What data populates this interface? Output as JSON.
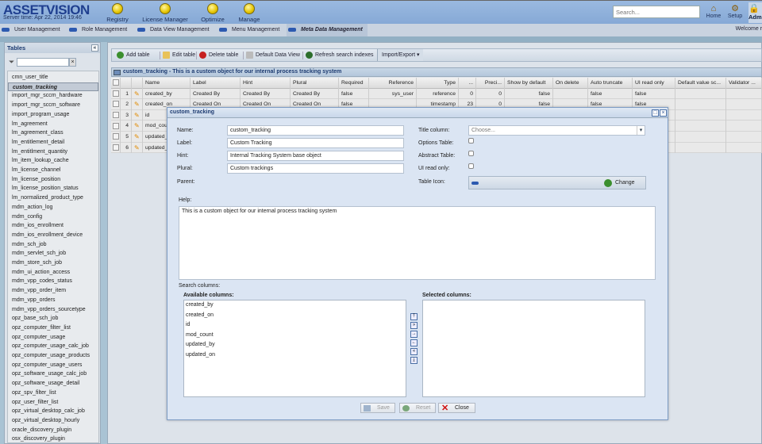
{
  "app": {
    "logo": "AssetVision",
    "server_time": "Server time: Apr 22, 2014 19:46"
  },
  "header": {
    "nav": [
      {
        "label": "Registry",
        "icon": "registry-icon"
      },
      {
        "label": "License Manager",
        "icon": "license-manager-icon"
      },
      {
        "label": "Optimize",
        "icon": "optimize-icon"
      },
      {
        "label": "Manage",
        "icon": "manage-icon"
      }
    ],
    "search_placeholder": "Search...",
    "right": [
      {
        "label": "Home",
        "icon": "home-icon"
      },
      {
        "label": "Setup",
        "icon": "setup-icon"
      },
      {
        "label": "Adm",
        "icon": "admin-icon"
      }
    ]
  },
  "subnav": {
    "tabs": [
      "User Management",
      "Role Management",
      "Data View Management",
      "Menu Management",
      "Meta Data Management"
    ],
    "active": "Meta Data Management",
    "welcome": "Welcome r"
  },
  "tables_panel": {
    "title": "Tables",
    "selected": "custom_tracking",
    "items": [
      "cmn_user_title",
      "custom_tracking",
      "import_mgr_sccm_hardware",
      "import_mgr_sccm_software",
      "import_program_usage",
      "lm_agreement",
      "lm_agreement_class",
      "lm_entitlement_detail",
      "lm_entitlment_quantity",
      "lm_item_lookup_cache",
      "lm_license_channel",
      "lm_license_position",
      "lm_license_position_status",
      "lm_normalized_product_type",
      "mdm_action_log",
      "mdm_config",
      "mdm_ios_enrollment",
      "mdm_ios_enrollment_device",
      "mdm_sch_job",
      "mdm_servlet_sch_job",
      "mdm_store_sch_job",
      "mdm_ui_action_access",
      "mdm_vpp_codes_status",
      "mdm_vpp_order_item",
      "mdm_vpp_orders",
      "mdm_vpp_orders_sourcetype",
      "opz_base_sch_job",
      "opz_computer_filter_list",
      "opz_computer_usage",
      "opz_computer_usage_calc_job",
      "opz_computer_usage_products",
      "opz_computer_usage_users",
      "opz_software_usage_calc_job",
      "opz_software_usage_detail",
      "opz_spv_filter_list",
      "opz_user_filter_list",
      "opz_virtual_desktop_calc_job",
      "opz_virtual_desktop_hourly",
      "oracle_discovery_plugin",
      "osx_discovery_plugin"
    ]
  },
  "toolbar": {
    "add": "Add table",
    "edit": "Edit table",
    "delete": "Delete table",
    "default_view": "Default Data View",
    "refresh": "Refresh search indexes",
    "import_export": "Import/Export"
  },
  "grid": {
    "title": "custom_tracking - This is a custom object for our internal process tracking system",
    "columns": [
      "Name",
      "Label",
      "Hint",
      "Plural",
      "Required",
      "Reference",
      "Type",
      "...",
      "Preci...",
      "Show by default",
      "On delete",
      "Auto truncate",
      "UI read only",
      "Default value sc...",
      "Validator ..."
    ],
    "rows": [
      [
        "1",
        "created_by",
        "Created By",
        "Created By",
        "Created By",
        "false",
        "sys_user",
        "reference",
        "0",
        "0",
        "false",
        "",
        "false",
        "false",
        "",
        ""
      ],
      [
        "2",
        "created_on",
        "Created On",
        "Created On",
        "Created On",
        "false",
        "",
        "timestamp",
        "23",
        "0",
        "false",
        "",
        "false",
        "false",
        "",
        ""
      ],
      [
        "3",
        "id",
        "",
        "",
        "",
        "",
        "",
        "",
        "",
        "",
        "",
        "",
        "",
        "",
        "",
        ""
      ],
      [
        "4",
        "mod_cou",
        "",
        "",
        "",
        "",
        "",
        "",
        "",
        "",
        "",
        "",
        "",
        "",
        "",
        ""
      ],
      [
        "5",
        "updated_",
        "",
        "",
        "",
        "",
        "",
        "",
        "",
        "",
        "",
        "",
        "",
        "",
        "",
        ""
      ],
      [
        "6",
        "updated_",
        "",
        "",
        "",
        "",
        "",
        "",
        "",
        "",
        "",
        "",
        "",
        "",
        "",
        ""
      ]
    ]
  },
  "dialog": {
    "title": "custom_tracking",
    "name_label": "Name:",
    "name_value": "custom_tracking",
    "label_label": "Label:",
    "label_value": "Custom Tracking",
    "hint_label": "Hint:",
    "hint_value": "Internal Tracking System base object",
    "plural_label": "Plural:",
    "plural_value": "Custom trackings",
    "parent_label": "Parent:",
    "title_column_label": "Title column:",
    "title_column_value": "Choose...",
    "options_table_label": "Options Table:",
    "options_table": false,
    "abstract_table_label": "Abstract Table:",
    "abstract_table": false,
    "ui_read_only_label": "UI read only:",
    "ui_read_only": false,
    "table_icon_label": "Table Icon:",
    "change_label": "Change",
    "help_label": "Help:",
    "help_value": "This is a custom object for our internal process tracking system",
    "search_columns_label": "Search columns:",
    "available_label": "Available columns:",
    "available": [
      "created_by",
      "created_on",
      "id",
      "mod_count",
      "updated_by",
      "updated_on"
    ],
    "selected_label": "Selected columns:",
    "selected": [],
    "save": "Save",
    "reset": "Reset",
    "close": "Close"
  }
}
